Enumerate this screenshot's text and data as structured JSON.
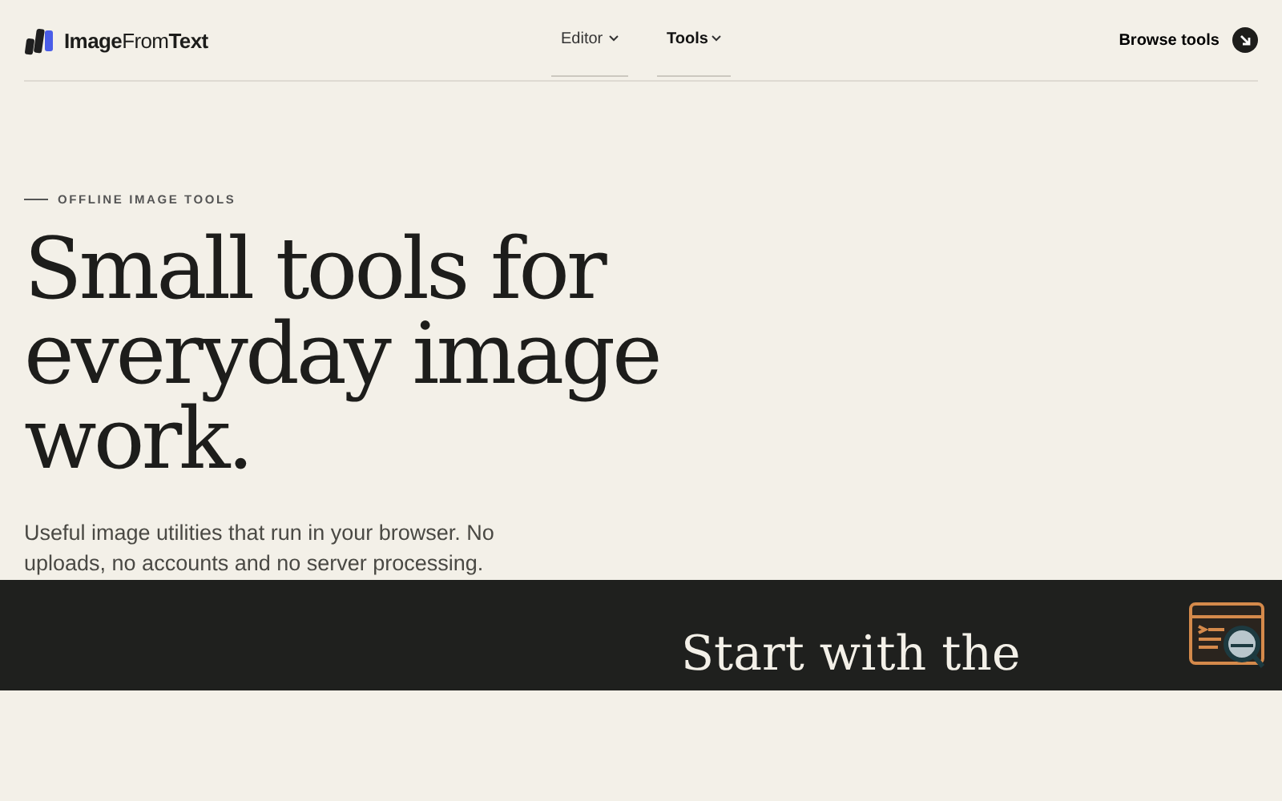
{
  "header": {
    "logo": "**Image**From**Text**",
    "nav": [
      {
        "label": "Editor",
        "selected": false
      },
      {
        "label": "Tools",
        "selected": true
      }
    ],
    "cta": "Browse tools"
  },
  "hero": {
    "eyebrow": "OFFLINE IMAGE TOOLS",
    "title": "Small tools for everyday image work.",
    "lead": "Useful image utilities that run in your browser. No uploads, no accounts and no server processing."
  },
  "dark_section": {
    "heading": "Start with the"
  }
}
